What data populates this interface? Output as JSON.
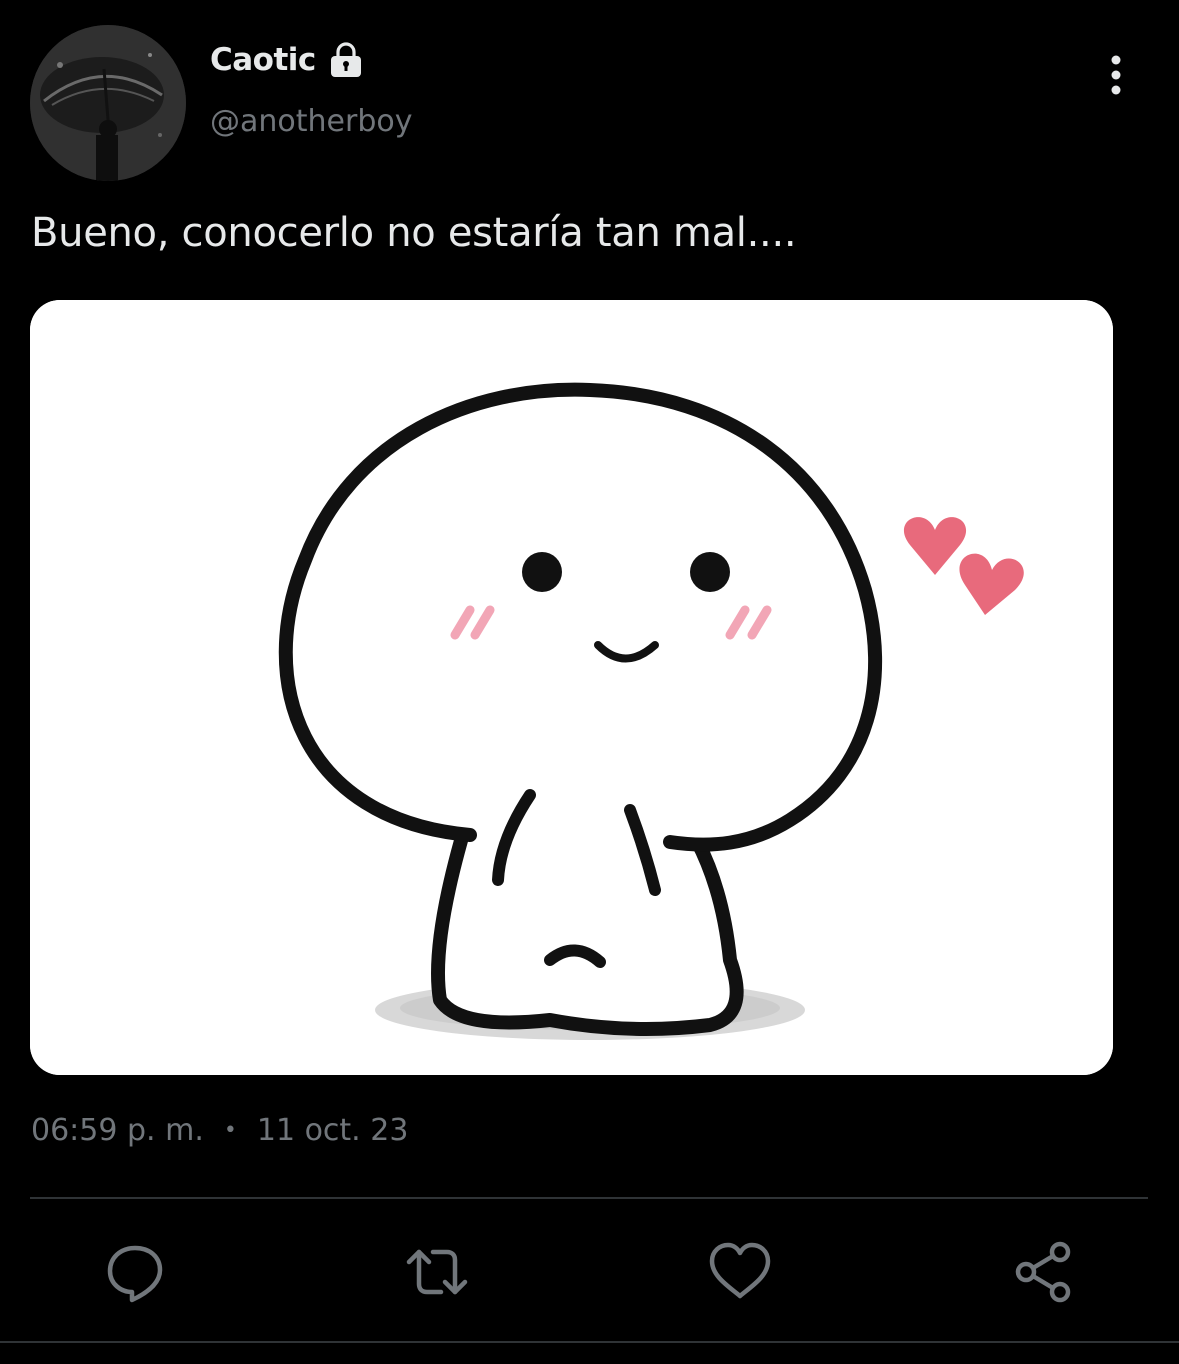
{
  "author": {
    "display_name": "Caotic",
    "handle": "@anotherboy",
    "avatar_icon": "umbrella-person-avatar",
    "protected_icon": "lock-icon"
  },
  "tweet": {
    "text": "Bueno, conocerlo no estaría tan mal....",
    "media_description_icon": "cute-blob-character-with-hearts"
  },
  "meta": {
    "time": "06:59 p. m.",
    "separator": "•",
    "date": "11 oct. 23"
  },
  "actions": [
    {
      "name": "reply",
      "icon": "reply-icon"
    },
    {
      "name": "retweet",
      "icon": "retweet-icon"
    },
    {
      "name": "like",
      "icon": "heart-icon"
    },
    {
      "name": "share",
      "icon": "share-icon"
    }
  ],
  "colors": {
    "background": "#000000",
    "primary_text": "#e7e9ea",
    "secondary_text": "#71767b",
    "divider": "#2f3336",
    "heart_accent": "#e86a7c"
  }
}
